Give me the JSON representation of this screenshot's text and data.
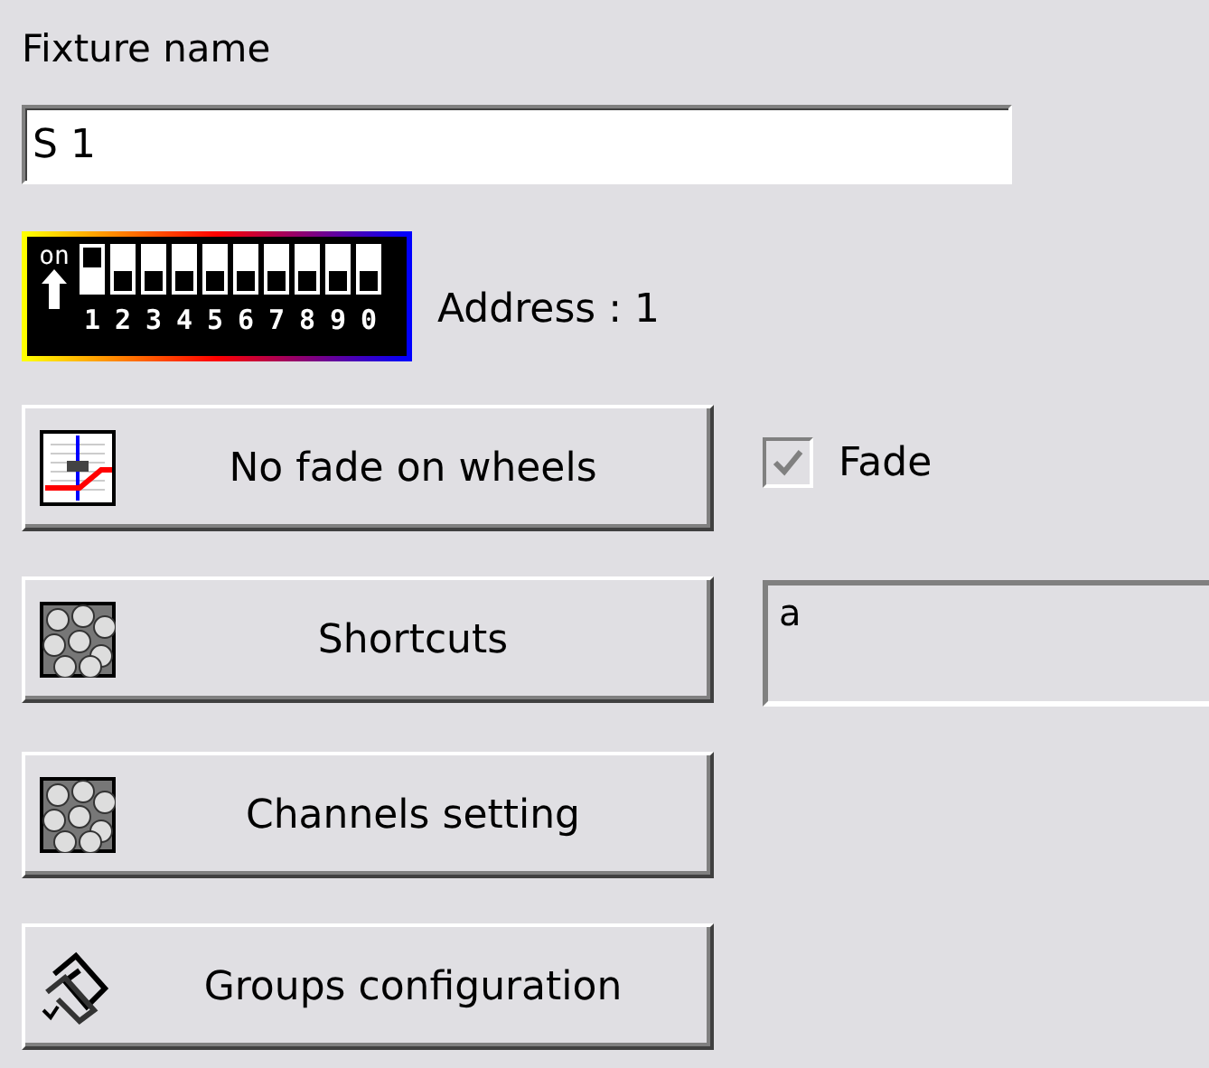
{
  "fixture_name": {
    "label": "Fixture name",
    "value": "S 1"
  },
  "dip_switch": {
    "on_label": "on",
    "switches": [
      {
        "label": "1",
        "on": true
      },
      {
        "label": "2",
        "on": false
      },
      {
        "label": "3",
        "on": false
      },
      {
        "label": "4",
        "on": false
      },
      {
        "label": "5",
        "on": false
      },
      {
        "label": "6",
        "on": false
      },
      {
        "label": "7",
        "on": false
      },
      {
        "label": "8",
        "on": false
      },
      {
        "label": "9",
        "on": false
      },
      {
        "label": "0",
        "on": false
      }
    ]
  },
  "address": "Address : 1",
  "rows": [
    {
      "button": {
        "label": "No fade on wheels"
      },
      "side": {
        "kind": "checkbox",
        "label": "Fade",
        "checked": true,
        "disabled": true
      }
    },
    {
      "button": {
        "label": "Shortcuts"
      },
      "side": {
        "kind": "field",
        "value": "a"
      }
    },
    {
      "button": {
        "label": "Channels setting"
      }
    },
    {
      "button": {
        "label": "Groups configuration"
      }
    }
  ]
}
